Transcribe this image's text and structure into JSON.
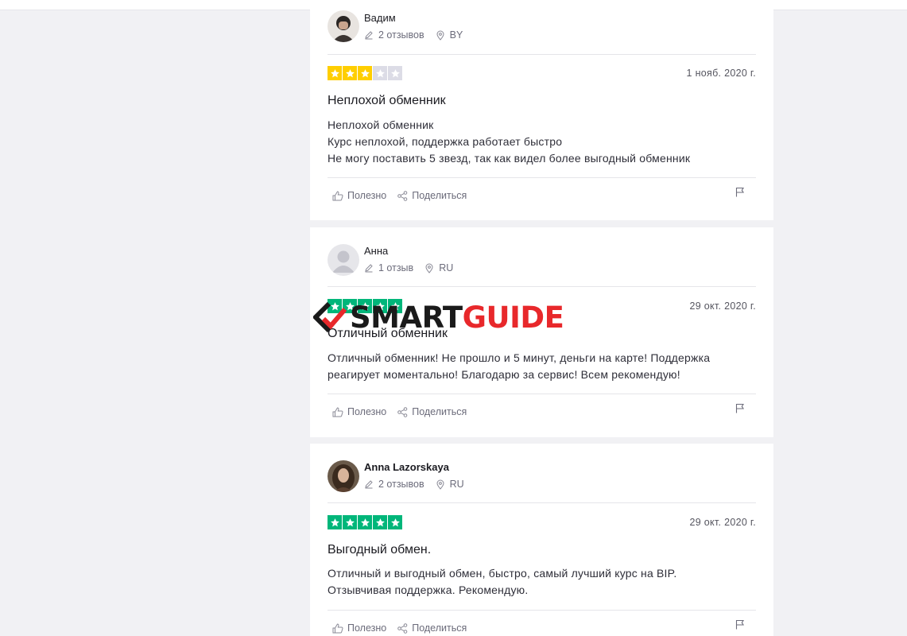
{
  "reviews": [
    {
      "name": "Вадим",
      "reviews_count": "2 отзывов",
      "country": "BY",
      "rating": 3,
      "date": "1 нояб. 2020 г.",
      "title": "Неплохой обменник",
      "body": [
        "Неплохой обменник",
        "Курс неплохой, поддержка работает быстро",
        "Не могу поставить 5 звезд, так как видел более выгодный обменник"
      ],
      "useful_label": "Полезно",
      "share_label": "Поделиться"
    },
    {
      "name": "Анна",
      "reviews_count": "1 отзыв",
      "country": "RU",
      "rating": 5,
      "date": "29 окт. 2020 г.",
      "title": "Отличный обменник",
      "body": [
        "Отличный обменник! Не прошло и 5 минут, деньги на карте! Поддержка",
        "реагирует моментально! Благодарю за сервис! Всем рекомендую!"
      ],
      "useful_label": "Полезно",
      "share_label": "Поделиться"
    },
    {
      "name": "Anna Lazorskaya",
      "reviews_count": "2 отзывов",
      "country": "RU",
      "rating": 5,
      "date": "29 окт. 2020 г.",
      "title": "Выгодный обмен.",
      "body": [
        "Отличный и выгодный обмен, быстро, самый лучший курс на BIP.",
        "Отзывчивая поддержка. Рекомендую."
      ],
      "useful_label": "Полезно",
      "share_label": "Поделиться"
    }
  ],
  "watermark": {
    "part1": "SMART",
    "part2": "GUIDE"
  },
  "colors": {
    "star_green": "#00b67a",
    "star_yellow": "#ffce00",
    "star_empty": "#dcdce6",
    "watermark_dark": "#1a1a1a",
    "watermark_red": "#e8282b"
  },
  "icons": {
    "pencil": "pencil-icon",
    "location": "location-pin-icon",
    "thumb": "thumbs-up-icon",
    "share": "share-icon",
    "flag": "flag-icon",
    "star": "star-icon"
  }
}
